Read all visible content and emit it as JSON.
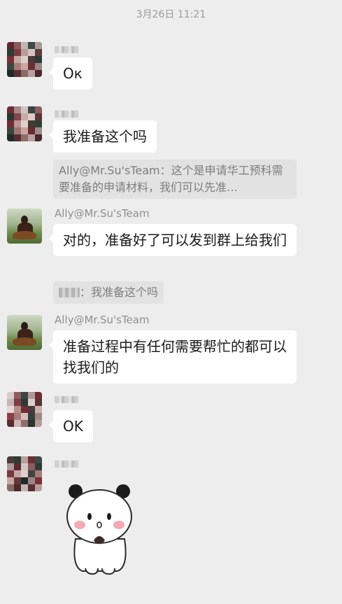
{
  "timestamp": "3月26日 11:21",
  "messages": [
    {
      "sender": "",
      "text": "Ок"
    },
    {
      "sender": "",
      "text": "我准备这个吗",
      "quote": "Ally@Mr.Su'sTeam：这个是申请华工预科需要准备的申请材料，我们可以先准…"
    },
    {
      "sender": "Ally@Mr.Su'sTeam",
      "text": "对的，准备好了可以发到群上给我们",
      "quote": "：我准备这个吗"
    },
    {
      "sender": "Ally@Mr.Su'sTeam",
      "text": "准备过程中有任何需要帮忙的都可以找我们的"
    },
    {
      "sender": "",
      "text": "OK"
    },
    {
      "sender": "",
      "sticker": "panda-sticker"
    }
  ],
  "colors": {
    "background": "#ededed",
    "bubble": "#ffffff",
    "quote": "#e2e2e2"
  }
}
